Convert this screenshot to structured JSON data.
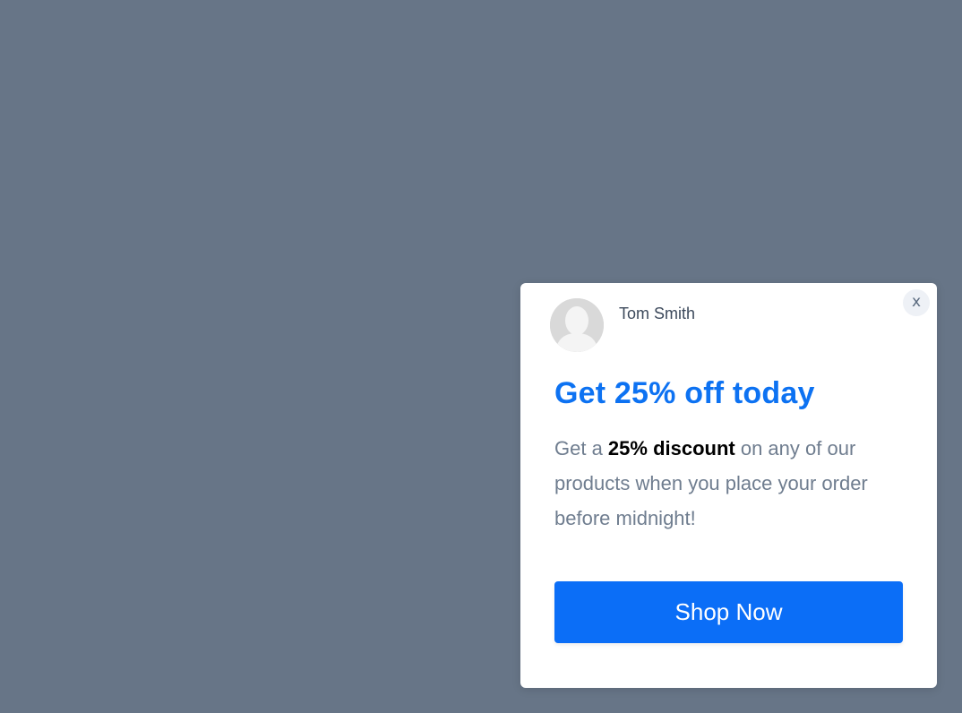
{
  "popup": {
    "close_label": "x",
    "sender_name": "Tom Smith",
    "avatar_icon": "user-placeholder-icon",
    "headline": "Get 25% off today",
    "body": {
      "prefix": "Get a ",
      "highlight": "25% discount",
      "suffix": " on any of our products when you place your order before midnight!"
    },
    "cta_label": "Shop Now"
  },
  "colors": {
    "backdrop": "#677587",
    "accent": "#0b6ef7",
    "headline": "#0d72f2",
    "body_text": "#6f7d8f"
  }
}
